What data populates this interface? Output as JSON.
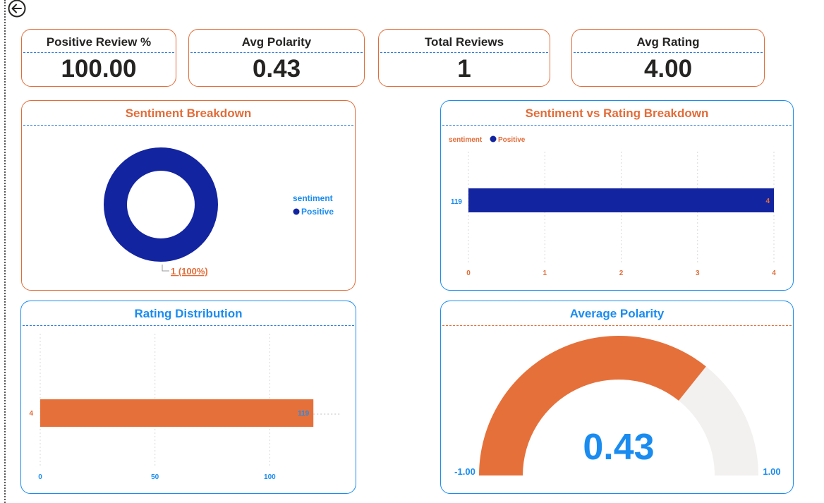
{
  "kpis": [
    {
      "label": "Positive Review %",
      "value": "100.00"
    },
    {
      "label": "Avg Polarity",
      "value": "0.43"
    },
    {
      "label": "Total Reviews",
      "value": "1"
    },
    {
      "label": "Avg Rating",
      "value": "4.00"
    }
  ],
  "sentiment_breakdown": {
    "title": "Sentiment Breakdown",
    "legend_title": "sentiment",
    "legend_item": "Positive",
    "data_label": "1 (100%)",
    "colors": {
      "positive": "#1324A0"
    }
  },
  "sentiment_vs_rating": {
    "title": "Sentiment vs Rating Breakdown",
    "legend_title": "sentiment",
    "legend_item": "Positive",
    "category_label": "119",
    "bar_value_label": "4",
    "x_ticks": [
      "0",
      "1",
      "2",
      "3",
      "4"
    ]
  },
  "rating_distribution": {
    "title": "Rating Distribution",
    "category_label": "4",
    "bar_value_label": "119",
    "x_ticks": [
      "0",
      "50",
      "100"
    ]
  },
  "average_polarity": {
    "title": "Average Polarity",
    "value": "0.43",
    "min_label": "-1.00",
    "max_label": "1.00"
  },
  "chart_data": [
    {
      "type": "pie",
      "title": "Sentiment Breakdown",
      "categories": [
        "Positive"
      ],
      "values": [
        1
      ],
      "labels": [
        "1 (100%)"
      ],
      "legend": {
        "title": "sentiment",
        "position": "right"
      }
    },
    {
      "type": "bar",
      "orientation": "horizontal",
      "title": "Sentiment vs Rating Breakdown",
      "categories": [
        "119"
      ],
      "series": [
        {
          "name": "Positive",
          "values": [
            4
          ]
        }
      ],
      "xlim": [
        0,
        4
      ],
      "grid": true,
      "legend": {
        "title": "sentiment",
        "position": "top-left"
      }
    },
    {
      "type": "bar",
      "orientation": "horizontal",
      "title": "Rating Distribution",
      "categories": [
        "4"
      ],
      "values": [
        119
      ],
      "xlim": [
        0,
        130
      ],
      "grid": true
    },
    {
      "type": "gauge",
      "title": "Average Polarity",
      "value": 0.43,
      "min": -1.0,
      "max": 1.0
    }
  ]
}
